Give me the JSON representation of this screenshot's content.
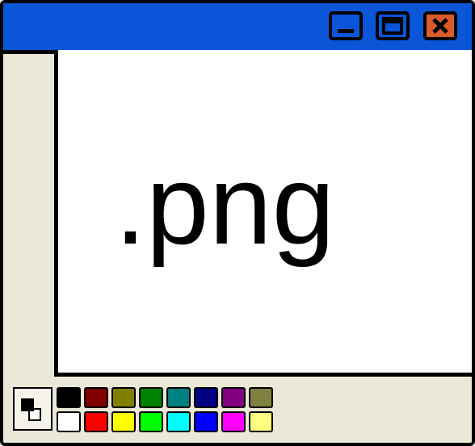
{
  "titlebar": {
    "color": "#0a55d8"
  },
  "controls": {
    "minimize": {
      "icon": "minimize-icon",
      "color": "#0a55d8"
    },
    "maximize": {
      "icon": "maximize-icon",
      "color": "#0a55d8"
    },
    "close": {
      "icon": "close-icon",
      "color": "#d95b2a"
    }
  },
  "canvas": {
    "text": ".png"
  },
  "current_colors": {
    "foreground": "#000000",
    "background": "#ffffff"
  },
  "palette": {
    "top_row": [
      "#000000",
      "#800000",
      "#808000",
      "#008000",
      "#008080",
      "#000080",
      "#800080",
      "#808040"
    ],
    "bottom_row": [
      "#ffffff",
      "#ff0000",
      "#ffff00",
      "#00ff00",
      "#00ffff",
      "#0000ff",
      "#ff00ff",
      "#ffff80"
    ]
  }
}
